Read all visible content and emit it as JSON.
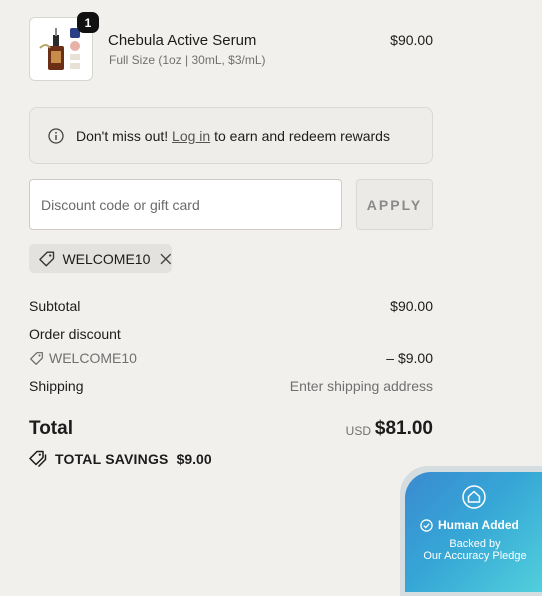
{
  "product": {
    "name": "Chebula Active Serum",
    "variant": "Full Size (1oz | 30mL, $3/mL)",
    "price": "$90.00",
    "quantity": "1"
  },
  "rewards": {
    "prefix": "Don't miss out!",
    "link": "Log in",
    "suffix": "to earn and redeem rewards"
  },
  "discount": {
    "placeholder": "Discount code or gift card",
    "value": "",
    "apply_label": "APPLY",
    "applied_code": "WELCOME10"
  },
  "summary": {
    "subtotal_label": "Subtotal",
    "subtotal_value": "$90.00",
    "order_discount_label": "Order discount",
    "discount_code": "WELCOME10",
    "discount_value": "– $9.00",
    "shipping_label": "Shipping",
    "shipping_value": "Enter shipping address",
    "total_label": "Total",
    "total_currency": "USD",
    "total_value": "$81.00",
    "savings_label": "TOTAL SAVINGS",
    "savings_value": "$9.00"
  },
  "badge": {
    "title": "Human Added",
    "line1": "Backed by",
    "line2": "Our Accuracy Pledge"
  },
  "colors": {
    "background": "#f2f0ed",
    "badge_gradient_start": "#3a8ad0",
    "badge_gradient_end": "#54d3dc"
  },
  "icons": {
    "rewards": "info-circle-icon",
    "coupon": "tag-icon",
    "remove": "close-icon",
    "savings": "tags-icon",
    "badge_top": "home-shield-icon",
    "badge_check": "check-circle-icon"
  }
}
